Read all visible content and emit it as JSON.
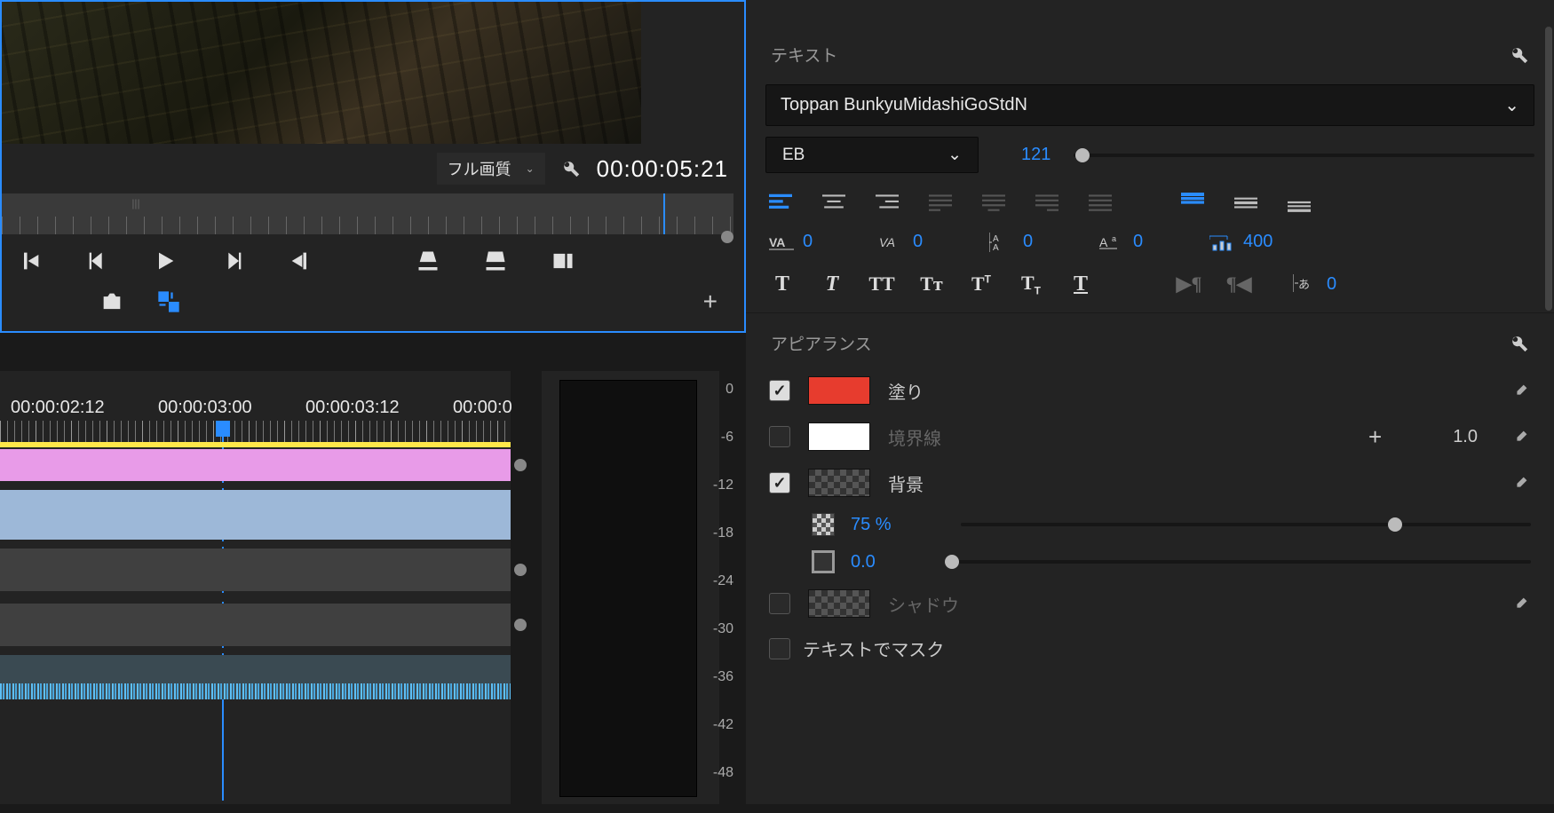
{
  "monitor": {
    "quality_label": "フル画質",
    "timecode": "00:00:05:21"
  },
  "timeline": {
    "times": [
      "00:00:02:12",
      "00:00:03:00",
      "00:00:03:12",
      "00:00:0"
    ]
  },
  "meter": {
    "marks": [
      "0",
      "-6",
      "-12",
      "-18",
      "-24",
      "-30",
      "-36",
      "-42",
      "-48"
    ]
  },
  "text_panel": {
    "title": "テキスト",
    "font_family": "Toppan BunkyuMidashiGoStdN",
    "font_style": "EB",
    "font_size": "121",
    "tracking": "0",
    "kerning": "0",
    "leading": "0",
    "baseline": "0",
    "tsume": "400",
    "indent": "0"
  },
  "appearance": {
    "title": "アピアランス",
    "fill_label": "塗り",
    "stroke_label": "境界線",
    "stroke_width": "1.0",
    "background_label": "背景",
    "opacity": "75 %",
    "size": "0.0",
    "shadow_label": "シャドウ",
    "mask_label": "テキストでマスク"
  }
}
